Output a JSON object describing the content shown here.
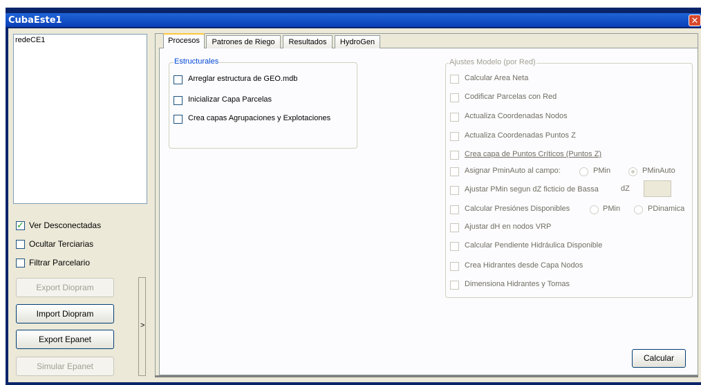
{
  "window": {
    "title": "CubaEste1",
    "close_icon": "close-icon"
  },
  "left": {
    "list_items": [
      "redeCE1"
    ],
    "options": [
      {
        "label": "Ver Desconectadas",
        "checked": true
      },
      {
        "label": "Ocultar Terciarias",
        "checked": false
      },
      {
        "label": "Filtrar Parcelario",
        "checked": false
      }
    ],
    "buttons": {
      "export_diopram": "Export Diopram",
      "import_diopram": "Import Diopram",
      "export_epanet": "Export Epanet",
      "simular_epanet": "Simular Epanet"
    },
    "splitter_arrow": ">"
  },
  "tabs": [
    "Procesos",
    "Patrones de Riego",
    "Resultados",
    "HydroGen"
  ],
  "estructurales": {
    "legend": "Estructurales",
    "items": [
      "Arreglar estructura de GEO.mdb",
      "Inicializar Capa Parcelas",
      "Crea capas Agrupaciones y Explotaciones"
    ]
  },
  "ajustes": {
    "legend": "Ajustes Modelo (por Red)",
    "items": [
      "Calcular Area Neta",
      "Codificar Parcelas con Red",
      "Actualiza Coordenadas Nodos",
      "Actualiza Coordenadas Puntos Z",
      "Crea capa de Puntos Críticos (Puntos Z)",
      "Asignar PminAuto al campo:",
      "Ajustar PMin segun dZ ficticio de Bassa",
      "Calcular Presiónes Disponibles",
      "Ajustar dH en nodos VRP",
      "Calcular Pendiente Hidráulica Disponible",
      "Crea Hidrantes desde Capa Nodos",
      "Dimensiona Hidrantes y Tomas"
    ],
    "asignar_radios": [
      "PMin",
      "PMinAuto"
    ],
    "dz_label": "dZ",
    "presiones_radios": [
      "PMin",
      "PDinamica"
    ]
  },
  "calcular_button": "Calcular"
}
